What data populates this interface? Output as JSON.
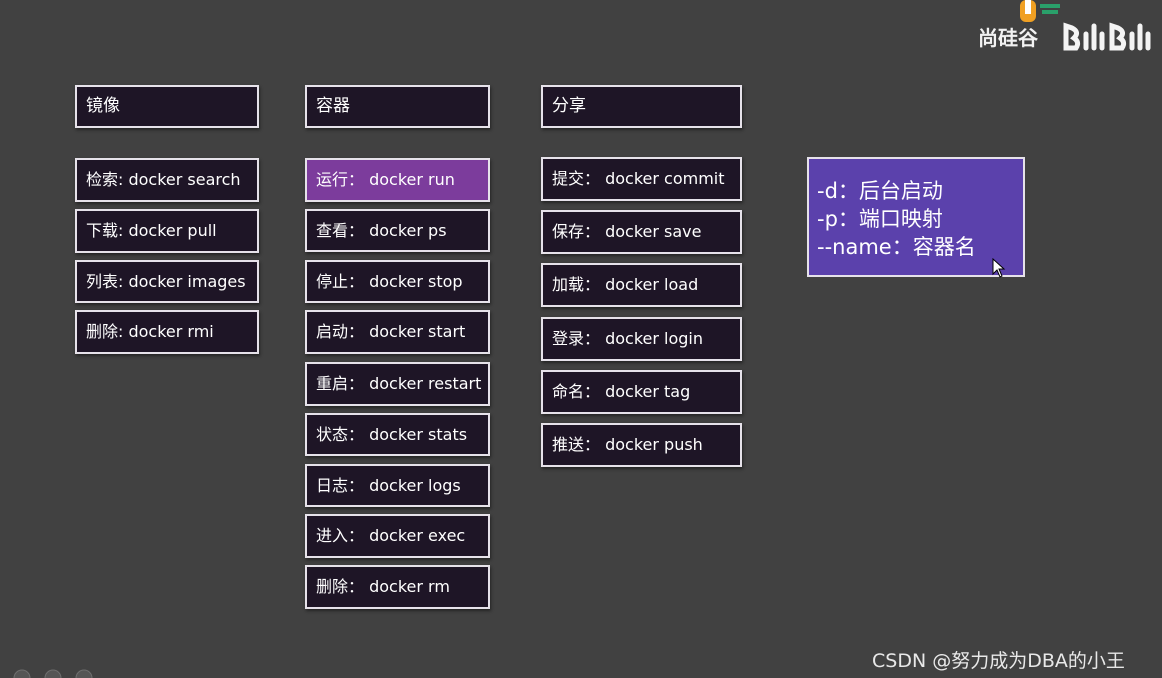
{
  "branding": {
    "company": "尚硅谷",
    "logo_icon": "atguigu-logo",
    "platform_icon": "bilibili-logo"
  },
  "columns": {
    "image": {
      "header": "镜像",
      "items": [
        "检索: docker search",
        "下载: docker pull",
        "列表: docker images",
        "删除: docker rmi"
      ]
    },
    "container": {
      "header": "容器",
      "items": [
        "运行： docker run",
        "查看： docker ps",
        "停止： docker stop",
        "启动： docker start",
        "重启： docker restart",
        "状态： docker stats",
        "日志： docker logs",
        "进入： docker exec",
        "删除： docker rm"
      ],
      "highlighted_item": "运行： docker run"
    },
    "share": {
      "header": "分享",
      "items": [
        "提交： docker commit",
        "保存： docker save",
        "加载： docker load",
        "登录： docker login",
        "命名： docker tag",
        "推送： docker push"
      ]
    }
  },
  "options": {
    "lines": [
      "-d：后台启动",
      "-p：端口映射",
      "--name：容器名"
    ]
  },
  "watermark": "CSDN @努力成为DBA的小王",
  "colors": {
    "background": "#414141",
    "box_fill": "#1e1526",
    "box_border": "#e6e2ea",
    "highlight": "#7c3c9c",
    "options_fill": "#5b41ac"
  }
}
